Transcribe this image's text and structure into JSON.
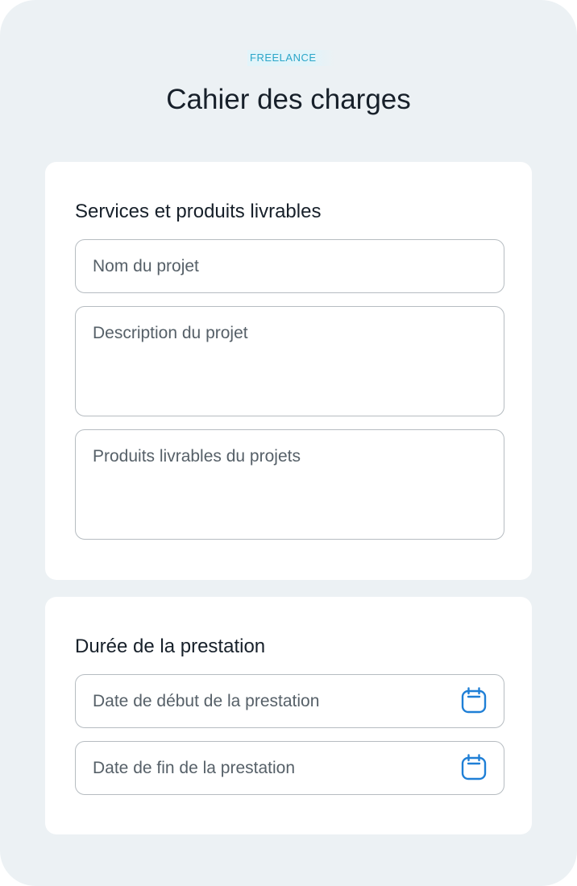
{
  "header": {
    "badge": "FREELANCE",
    "title": "Cahier des charges"
  },
  "services": {
    "heading": "Services et produits livrables",
    "project_name_placeholder": "Nom du projet",
    "project_description_placeholder": "Description du projet",
    "project_deliverables_placeholder": "Produits livrables du projets"
  },
  "duration": {
    "heading": "Durée de la prestation",
    "start_date_placeholder": "Date de début de la prestation",
    "end_date_placeholder": "Date de fin de la prestation",
    "icon": "calendar-icon"
  },
  "colors": {
    "background": "#ecf1f4",
    "card": "#ffffff",
    "badge_text": "#2aa6c9",
    "icon_accent": "#1f7fd6",
    "field_border": "#b6bcc1",
    "title_text": "#17202a",
    "placeholder_text": "#566068"
  }
}
